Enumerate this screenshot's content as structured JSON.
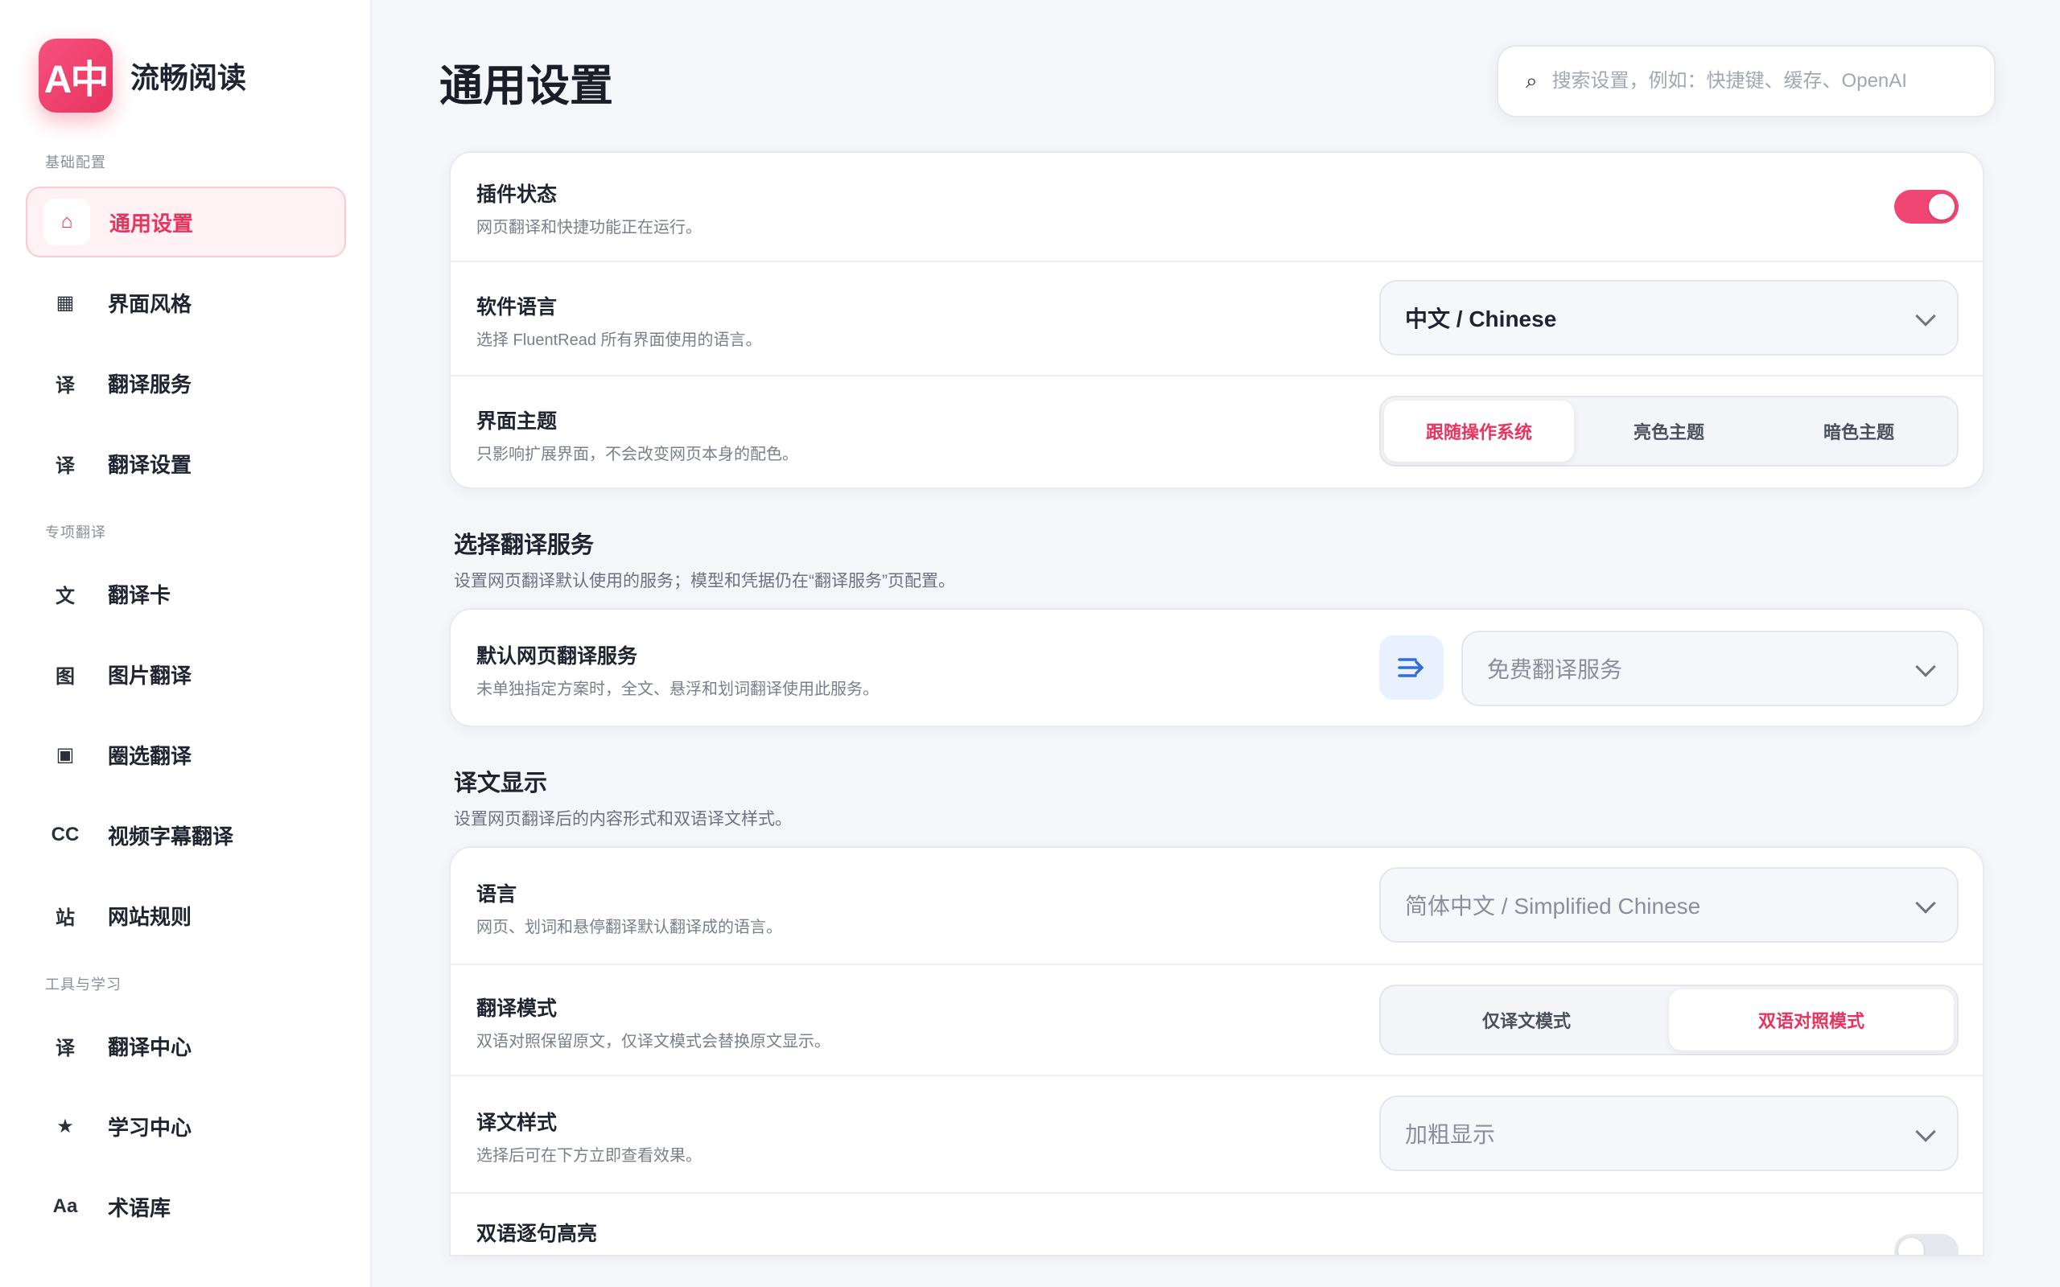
{
  "brand": {
    "logo_text": "A中",
    "title": "流畅阅读"
  },
  "sidebar": {
    "groups": [
      {
        "label": "基础配置",
        "items": [
          {
            "icon": "home-icon",
            "glyph": "⌂",
            "label": "通用设置"
          },
          {
            "icon": "palette-icon",
            "glyph": "▦",
            "label": "界面风格"
          },
          {
            "icon": "translate-icon",
            "glyph": "译",
            "label": "翻译服务"
          },
          {
            "icon": "translate-icon",
            "glyph": "译",
            "label": "翻译设置"
          }
        ]
      },
      {
        "label": "专项翻译",
        "items": [
          {
            "icon": "text-card-icon",
            "glyph": "文",
            "label": "翻译卡"
          },
          {
            "icon": "image-icon",
            "glyph": "图",
            "label": "图片翻译"
          },
          {
            "icon": "selection-icon",
            "glyph": "▣",
            "label": "圈选翻译"
          },
          {
            "icon": "subtitle-icon",
            "glyph": "CC",
            "label": "视频字幕翻译"
          },
          {
            "icon": "site-icon",
            "glyph": "站",
            "label": "网站规则"
          }
        ]
      },
      {
        "label": "工具与学习",
        "items": [
          {
            "icon": "translate-icon",
            "glyph": "译",
            "label": "翻译中心"
          },
          {
            "icon": "star-icon",
            "glyph": "★",
            "label": "学习中心"
          },
          {
            "icon": "glossary-icon",
            "glyph": "Aa",
            "label": "术语库"
          }
        ]
      }
    ]
  },
  "page": {
    "title": "通用设置"
  },
  "search": {
    "icon_glyph": "⌕",
    "placeholder": "搜索设置，例如：快捷键、缓存、OpenAI"
  },
  "general": {
    "plugin_status": {
      "title": "插件状态",
      "desc": "网页翻译和快捷功能正在运行。",
      "enabled": true
    },
    "language": {
      "title": "软件语言",
      "desc": "选择 FluentRead 所有界面使用的语言。",
      "value": "中文 / Chinese"
    },
    "theme": {
      "title": "界面主题",
      "desc": "只影响扩展界面，不会改变网页本身的配色。",
      "options": [
        "跟随操作系统",
        "亮色主题",
        "暗色主题"
      ],
      "selected": "跟随操作系统"
    }
  },
  "service_section": {
    "title": "选择翻译服务",
    "desc": "设置网页翻译默认使用的服务；模型和凭据仍在“翻译服务”页配置。",
    "default_service": {
      "title": "默认网页翻译服务",
      "desc": "未单独指定方案时，全文、悬浮和划词翻译使用此服务。",
      "value": "免费翻译服务"
    }
  },
  "display_section": {
    "title": "译文显示",
    "desc": "设置网页翻译后的内容形式和双语译文样式。",
    "language": {
      "title": "语言",
      "desc": "网页、划词和悬停翻译默认翻译成的语言。",
      "value": "简体中文 / Simplified Chinese"
    },
    "mode": {
      "title": "翻译模式",
      "desc": "双语对照保留原文，仅译文模式会替换原文显示。",
      "options": [
        "仅译文模式",
        "双语对照模式"
      ],
      "selected": "双语对照模式"
    },
    "style": {
      "title": "译文样式",
      "desc": "选择后可在下方立即查看效果。",
      "value": "加粗显示"
    },
    "highlight": {
      "title": "双语逐句高亮",
      "enabled": false
    }
  },
  "colors": {
    "accent": "#e8335f",
    "toggle_on": "#ef4673",
    "service_icon": "#2f6fd6"
  }
}
